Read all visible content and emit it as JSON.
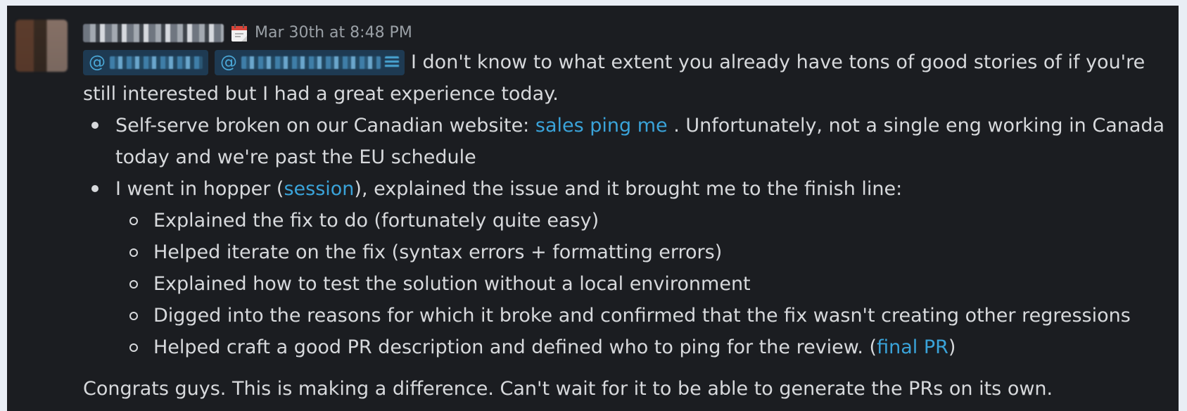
{
  "message": {
    "timestamp": "Mar 30th at 8:48 PM",
    "mentions": [
      {
        "at": "@"
      },
      {
        "at": "@"
      }
    ],
    "intro_line1": "I don't know to what extent you already have tons of good stories of if you're",
    "intro_line2": "still interested but I had a great experience today.",
    "bullet1": {
      "before": "Self-serve broken on our Canadian website: ",
      "link": "sales ping me",
      "after_line1": " . Unfortunately, not a single eng working in Canada",
      "line2": "today and we're past the EU schedule"
    },
    "bullet2": {
      "before": "I went in hopper (",
      "link": "session",
      "after": "), explained the issue and it brought me to the finish line:",
      "subitems": [
        "Explained the fix to do (fortunately quite easy)",
        "Helped iterate on the fix (syntax errors + formatting errors)",
        "Explained how to test the solution without a local environment",
        "Digged into the reasons for which it broke and confirmed that the fix wasn't creating other regressions"
      ],
      "last_sub_before": "Helped craft a good PR description and defined who to ping for the review. (",
      "last_sub_link": "final PR",
      "last_sub_after": ")"
    },
    "closing": "Congrats guys. This is making a difference. Can't wait for it to be able to generate the PRs on its own."
  },
  "colors": {
    "background": "#1b1d21",
    "text": "#d7d9dc",
    "link": "#3aa3d9",
    "mention_bg": "#1e3a52",
    "timestamp": "#9aa0a6"
  }
}
